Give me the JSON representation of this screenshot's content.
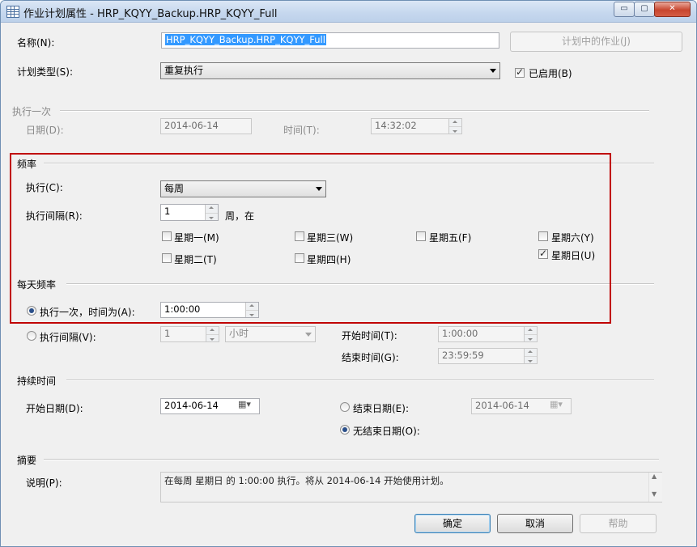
{
  "window": {
    "title": "作业计划属性 - HRP_KQYY_Backup.HRP_KQYY_Full",
    "min_glyph": "▭",
    "max_glyph": "▢",
    "close_glyph": "✕"
  },
  "name": {
    "label": "名称(N):",
    "value": "HRP_KQYY_Backup.HRP_KQYY_Full",
    "jobs_button": "计划中的作业(J)"
  },
  "schedule_type": {
    "label": "计划类型(S):",
    "value": "重复执行",
    "enabled_label": "已启用(B)",
    "enabled": true
  },
  "one_time": {
    "section": "执行一次",
    "date_label": "日期(D):",
    "date_value": "2014-06-14",
    "time_label": "时间(T):",
    "time_value": "14:32:02"
  },
  "frequency": {
    "section": "频率",
    "occurs_label": "执行(C):",
    "occurs_value": "每周",
    "recurs_label": "执行间隔(R):",
    "recurs_value": "1",
    "recurs_unit": "周，在",
    "days": [
      {
        "label": "星期一(M)",
        "checked": false
      },
      {
        "label": "星期二(T)",
        "checked": false
      },
      {
        "label": "星期三(W)",
        "checked": false
      },
      {
        "label": "星期四(H)",
        "checked": false
      },
      {
        "label": "星期五(F)",
        "checked": false
      },
      {
        "label": "星期六(Y)",
        "checked": false
      },
      {
        "label": "星期日(U)",
        "checked": true
      }
    ]
  },
  "daily": {
    "section": "每天频率",
    "once_label": "执行一次，时间为(A):",
    "once_value": "1:00:00",
    "once_selected": true,
    "every_label": "执行间隔(V):",
    "every_value": "1",
    "every_unit": "小时",
    "start_label": "开始时间(T):",
    "start_value": "1:00:00",
    "end_label": "结束时间(G):",
    "end_value": "23:59:59"
  },
  "duration": {
    "section": "持续时间",
    "start_label": "开始日期(D):",
    "start_value": "2014-06-14",
    "end_label": "结束日期(E):",
    "end_value": "2014-06-14",
    "noend_label": "无结束日期(O):",
    "noend_selected": true
  },
  "summary": {
    "section": "摘要",
    "desc_label": "说明(P):",
    "desc_value": "在每周 星期日 的 1:00:00 执行。将从 2014-06-14 开始使用计划。"
  },
  "buttons": {
    "ok": "确定",
    "cancel": "取消",
    "help": "帮助"
  },
  "colors": {
    "highlight_box": "#c00000",
    "selection": "#3399ff"
  }
}
